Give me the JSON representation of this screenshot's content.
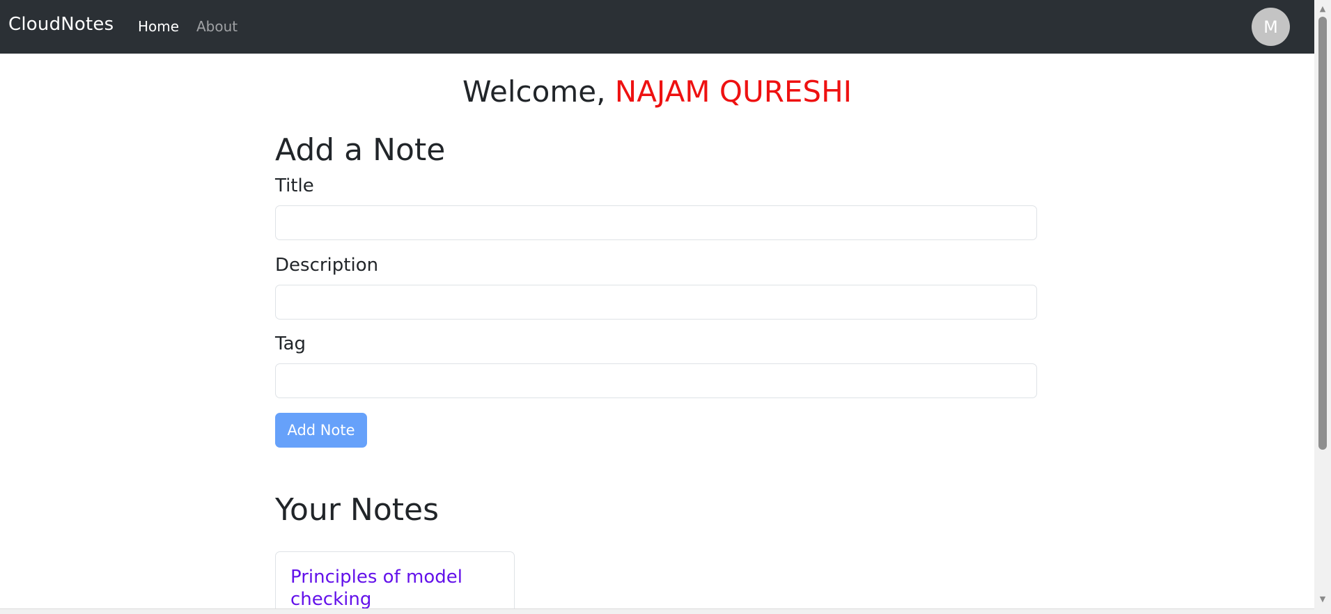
{
  "navbar": {
    "brand": "CloudNotes",
    "links": [
      {
        "label": "Home",
        "active": true
      },
      {
        "label": "About",
        "active": false
      }
    ],
    "avatar_initial": "M"
  },
  "welcome": {
    "prefix": "Welcome, ",
    "user_name": "NAJAM QURESHI"
  },
  "form": {
    "heading": "Add a Note",
    "title_label": "Title",
    "title_value": "",
    "description_label": "Description",
    "description_value": "",
    "tag_label": "Tag",
    "tag_value": "",
    "submit_label": "Add Note"
  },
  "notes": {
    "heading": "Your Notes",
    "items": [
      {
        "title": "Principles of model checking"
      }
    ]
  },
  "colors": {
    "navbar_bg": "#2b3035",
    "user_name": "#ee1111",
    "button_bg": "#66a1fa",
    "note_title": "#6311ea"
  }
}
